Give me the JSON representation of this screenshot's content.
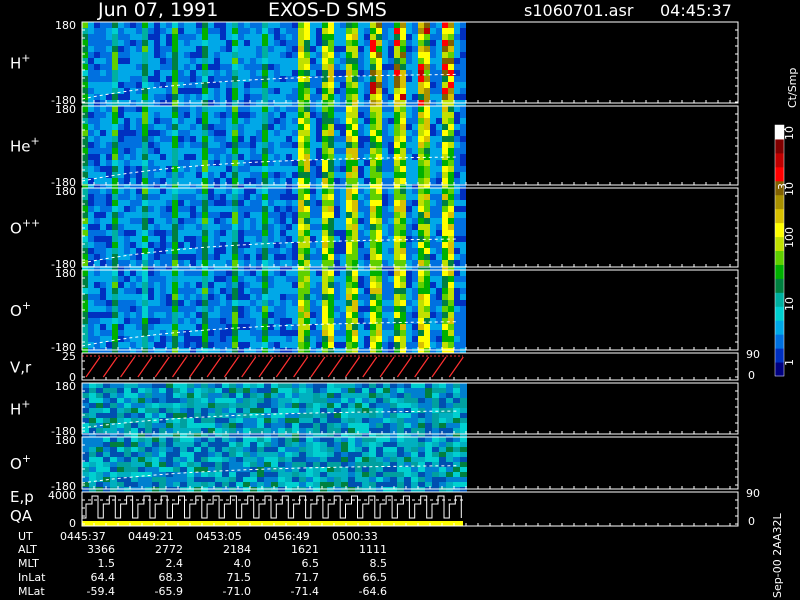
{
  "header": {
    "date": "Jun 07, 1991",
    "instrument": "EXOS-D SMS",
    "file": "s1060701.asr",
    "time": "04:45:37"
  },
  "colorbar": {
    "title": "Ct/Smp",
    "tick_labels": [
      "1",
      "10",
      "100",
      "10",
      "3",
      "10",
      "4"
    ],
    "colors": [
      "#000080",
      "#0030c0",
      "#0070e0",
      "#00a8e8",
      "#00d0d0",
      "#00b0a0",
      "#008040",
      "#00b000",
      "#60d000",
      "#c0e000",
      "#ffff00",
      "#d8c000",
      "#a89000",
      "#806000",
      "#ff0000",
      "#c00000",
      "#800000",
      "#ffffff"
    ]
  },
  "chart_data": {
    "type": "heatmap",
    "title": "Jun 07, 1991   EXOS-D SMS",
    "panels": [
      {
        "label": "H",
        "sup": "+",
        "ytop": "180",
        "ybot": "-180"
      },
      {
        "label": "He",
        "sup": "+",
        "ytop": "180",
        "ybot": "-180"
      },
      {
        "label": "O",
        "sup": "++",
        "ytop": "180",
        "ybot": "-180"
      },
      {
        "label": "O",
        "sup": "+",
        "ytop": "180",
        "ybot": "-180"
      },
      {
        "label": "V,r",
        "sup": "",
        "ytop": "25",
        "ybot": "0",
        "right_top": "90",
        "right_bot": "0"
      },
      {
        "label": "H",
        "sup": "+",
        "ytop": "180",
        "ybot": "-180"
      },
      {
        "label": "O",
        "sup": "+",
        "ytop": "180",
        "ybot": "-180"
      },
      {
        "label": "E,p",
        "sup": "",
        "label2": "QA",
        "ytop": "4000",
        "ybot": "0",
        "right_top": "90",
        "right_bot": "0"
      }
    ],
    "footer_rows": [
      {
        "name": "UT",
        "values": [
          "0445:37",
          "0449:21",
          "0453:05",
          "0456:49",
          "0500:33"
        ]
      },
      {
        "name": "ALT",
        "values": [
          "3366",
          "2772",
          "2184",
          "1621",
          "1111"
        ]
      },
      {
        "name": "MLT",
        "values": [
          "1.5",
          "2.4",
          "4.0",
          "6.5",
          "8.5"
        ]
      },
      {
        "name": "InLat",
        "values": [
          "64.4",
          "68.3",
          "71.5",
          "71.7",
          "66.5"
        ]
      },
      {
        "name": "MLat",
        "values": [
          "-59.4",
          "-65.9",
          "-71.0",
          "-71.4",
          "-64.6"
        ]
      }
    ],
    "side_note": "Sep-00  2AA32L"
  }
}
